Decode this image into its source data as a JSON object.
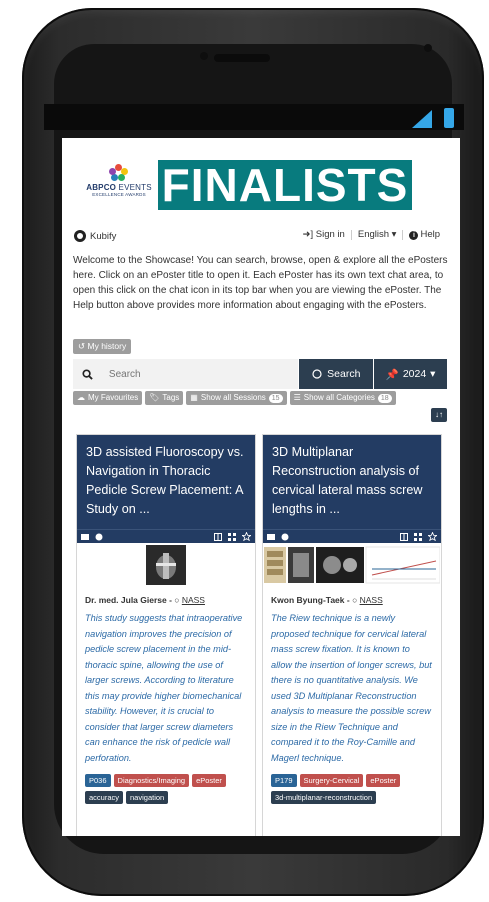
{
  "banner": {
    "org_name": "ABPCO",
    "org_events": "EVENTS",
    "org_sub": "EXCELLENCE AWARDS",
    "title": "FINALISTS"
  },
  "topbar": {
    "brand": "Kubify",
    "sign_in": "Sign in",
    "language": "English",
    "help": "Help"
  },
  "welcome_text": "Welcome to the Showcase! You can search, browse, open & explore all the ePosters here. Click on an ePoster title to open it. Each ePoster has its own text chat area, to open this click on the chat icon in its top bar when you are viewing the ePoster. The Help button above provides more information about engaging with the ePosters.",
  "history_label": "My history",
  "search": {
    "placeholder": "Search",
    "button_label": "Search",
    "year": "2024"
  },
  "filters": {
    "favourites": "My Favourites",
    "tags": "Tags",
    "sessions": "Show all Sessions",
    "sessions_count": "15",
    "categories": "Show all Categories",
    "categories_count": "18"
  },
  "cards": [
    {
      "title": "3D assisted Fluoroscopy vs. Navigation in Thoracic Pedicle Screw Placement: A Study on ...",
      "author": "Dr. med. Jula Gierse - ",
      "org": "NASS",
      "abstract": "This study suggests that intraoperative navigation improves the precision of pedicle screw placement in the mid-thoracic spine, allowing the use of larger screws. According to literature this may provide higher biomechanical stability. However, it is crucial to consider that larger screw diameters can enhance the risk of pedicle wall perforation.",
      "tags": [
        {
          "label": "P036",
          "color": "blue"
        },
        {
          "label": "Diagnostics/Imaging",
          "color": "red"
        },
        {
          "label": "ePoster",
          "color": "red"
        },
        {
          "label": "accuracy",
          "color": "dark"
        },
        {
          "label": "navigation",
          "color": "dark"
        }
      ]
    },
    {
      "title": "3D Multiplanar Reconstruction analysis of cervical lateral mass screw lengths in ...",
      "author": "Kwon Byung-Taek - ",
      "org": "NASS",
      "abstract": "The Riew technique is a newly proposed technique for cervical lateral mass screw fixation. It is known to allow the insertion of longer screws, but there is no quantitative analysis. We used 3D Multiplanar Reconstruction analysis to measure the possible screw size in the Riew Technique and compared it to the Roy-Camille and Magerl technique.",
      "tags": [
        {
          "label": "P179",
          "color": "blue"
        },
        {
          "label": "Surgery-Cervical",
          "color": "red"
        },
        {
          "label": "ePoster",
          "color": "red"
        },
        {
          "label": "3d-multiplanar-reconstruction",
          "color": "dark"
        }
      ]
    }
  ],
  "colors": {
    "banner_teal": "#087b7e",
    "navy": "#233c63",
    "abstract_blue": "#2c6aa6",
    "tag_blue": "#2a6496",
    "tag_red": "#c0504d",
    "status_battery": "#35a7e8"
  }
}
